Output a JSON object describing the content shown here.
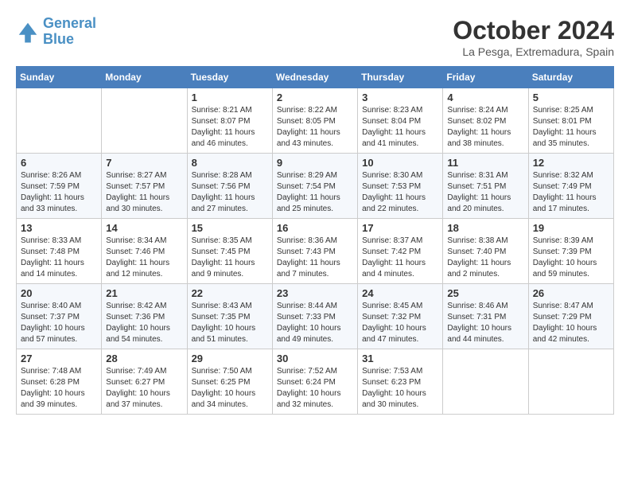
{
  "logo": {
    "line1": "General",
    "line2": "Blue"
  },
  "title": "October 2024",
  "subtitle": "La Pesga, Extremadura, Spain",
  "weekdays": [
    "Sunday",
    "Monday",
    "Tuesday",
    "Wednesday",
    "Thursday",
    "Friday",
    "Saturday"
  ],
  "weeks": [
    [
      {
        "day": "",
        "sunrise": "",
        "sunset": "",
        "daylight": ""
      },
      {
        "day": "",
        "sunrise": "",
        "sunset": "",
        "daylight": ""
      },
      {
        "day": "1",
        "sunrise": "Sunrise: 8:21 AM",
        "sunset": "Sunset: 8:07 PM",
        "daylight": "Daylight: 11 hours and 46 minutes."
      },
      {
        "day": "2",
        "sunrise": "Sunrise: 8:22 AM",
        "sunset": "Sunset: 8:05 PM",
        "daylight": "Daylight: 11 hours and 43 minutes."
      },
      {
        "day": "3",
        "sunrise": "Sunrise: 8:23 AM",
        "sunset": "Sunset: 8:04 PM",
        "daylight": "Daylight: 11 hours and 41 minutes."
      },
      {
        "day": "4",
        "sunrise": "Sunrise: 8:24 AM",
        "sunset": "Sunset: 8:02 PM",
        "daylight": "Daylight: 11 hours and 38 minutes."
      },
      {
        "day": "5",
        "sunrise": "Sunrise: 8:25 AM",
        "sunset": "Sunset: 8:01 PM",
        "daylight": "Daylight: 11 hours and 35 minutes."
      }
    ],
    [
      {
        "day": "6",
        "sunrise": "Sunrise: 8:26 AM",
        "sunset": "Sunset: 7:59 PM",
        "daylight": "Daylight: 11 hours and 33 minutes."
      },
      {
        "day": "7",
        "sunrise": "Sunrise: 8:27 AM",
        "sunset": "Sunset: 7:57 PM",
        "daylight": "Daylight: 11 hours and 30 minutes."
      },
      {
        "day": "8",
        "sunrise": "Sunrise: 8:28 AM",
        "sunset": "Sunset: 7:56 PM",
        "daylight": "Daylight: 11 hours and 27 minutes."
      },
      {
        "day": "9",
        "sunrise": "Sunrise: 8:29 AM",
        "sunset": "Sunset: 7:54 PM",
        "daylight": "Daylight: 11 hours and 25 minutes."
      },
      {
        "day": "10",
        "sunrise": "Sunrise: 8:30 AM",
        "sunset": "Sunset: 7:53 PM",
        "daylight": "Daylight: 11 hours and 22 minutes."
      },
      {
        "day": "11",
        "sunrise": "Sunrise: 8:31 AM",
        "sunset": "Sunset: 7:51 PM",
        "daylight": "Daylight: 11 hours and 20 minutes."
      },
      {
        "day": "12",
        "sunrise": "Sunrise: 8:32 AM",
        "sunset": "Sunset: 7:49 PM",
        "daylight": "Daylight: 11 hours and 17 minutes."
      }
    ],
    [
      {
        "day": "13",
        "sunrise": "Sunrise: 8:33 AM",
        "sunset": "Sunset: 7:48 PM",
        "daylight": "Daylight: 11 hours and 14 minutes."
      },
      {
        "day": "14",
        "sunrise": "Sunrise: 8:34 AM",
        "sunset": "Sunset: 7:46 PM",
        "daylight": "Daylight: 11 hours and 12 minutes."
      },
      {
        "day": "15",
        "sunrise": "Sunrise: 8:35 AM",
        "sunset": "Sunset: 7:45 PM",
        "daylight": "Daylight: 11 hours and 9 minutes."
      },
      {
        "day": "16",
        "sunrise": "Sunrise: 8:36 AM",
        "sunset": "Sunset: 7:43 PM",
        "daylight": "Daylight: 11 hours and 7 minutes."
      },
      {
        "day": "17",
        "sunrise": "Sunrise: 8:37 AM",
        "sunset": "Sunset: 7:42 PM",
        "daylight": "Daylight: 11 hours and 4 minutes."
      },
      {
        "day": "18",
        "sunrise": "Sunrise: 8:38 AM",
        "sunset": "Sunset: 7:40 PM",
        "daylight": "Daylight: 11 hours and 2 minutes."
      },
      {
        "day": "19",
        "sunrise": "Sunrise: 8:39 AM",
        "sunset": "Sunset: 7:39 PM",
        "daylight": "Daylight: 10 hours and 59 minutes."
      }
    ],
    [
      {
        "day": "20",
        "sunrise": "Sunrise: 8:40 AM",
        "sunset": "Sunset: 7:37 PM",
        "daylight": "Daylight: 10 hours and 57 minutes."
      },
      {
        "day": "21",
        "sunrise": "Sunrise: 8:42 AM",
        "sunset": "Sunset: 7:36 PM",
        "daylight": "Daylight: 10 hours and 54 minutes."
      },
      {
        "day": "22",
        "sunrise": "Sunrise: 8:43 AM",
        "sunset": "Sunset: 7:35 PM",
        "daylight": "Daylight: 10 hours and 51 minutes."
      },
      {
        "day": "23",
        "sunrise": "Sunrise: 8:44 AM",
        "sunset": "Sunset: 7:33 PM",
        "daylight": "Daylight: 10 hours and 49 minutes."
      },
      {
        "day": "24",
        "sunrise": "Sunrise: 8:45 AM",
        "sunset": "Sunset: 7:32 PM",
        "daylight": "Daylight: 10 hours and 47 minutes."
      },
      {
        "day": "25",
        "sunrise": "Sunrise: 8:46 AM",
        "sunset": "Sunset: 7:31 PM",
        "daylight": "Daylight: 10 hours and 44 minutes."
      },
      {
        "day": "26",
        "sunrise": "Sunrise: 8:47 AM",
        "sunset": "Sunset: 7:29 PM",
        "daylight": "Daylight: 10 hours and 42 minutes."
      }
    ],
    [
      {
        "day": "27",
        "sunrise": "Sunrise: 7:48 AM",
        "sunset": "Sunset: 6:28 PM",
        "daylight": "Daylight: 10 hours and 39 minutes."
      },
      {
        "day": "28",
        "sunrise": "Sunrise: 7:49 AM",
        "sunset": "Sunset: 6:27 PM",
        "daylight": "Daylight: 10 hours and 37 minutes."
      },
      {
        "day": "29",
        "sunrise": "Sunrise: 7:50 AM",
        "sunset": "Sunset: 6:25 PM",
        "daylight": "Daylight: 10 hours and 34 minutes."
      },
      {
        "day": "30",
        "sunrise": "Sunrise: 7:52 AM",
        "sunset": "Sunset: 6:24 PM",
        "daylight": "Daylight: 10 hours and 32 minutes."
      },
      {
        "day": "31",
        "sunrise": "Sunrise: 7:53 AM",
        "sunset": "Sunset: 6:23 PM",
        "daylight": "Daylight: 10 hours and 30 minutes."
      },
      {
        "day": "",
        "sunrise": "",
        "sunset": "",
        "daylight": ""
      },
      {
        "day": "",
        "sunrise": "",
        "sunset": "",
        "daylight": ""
      }
    ]
  ]
}
